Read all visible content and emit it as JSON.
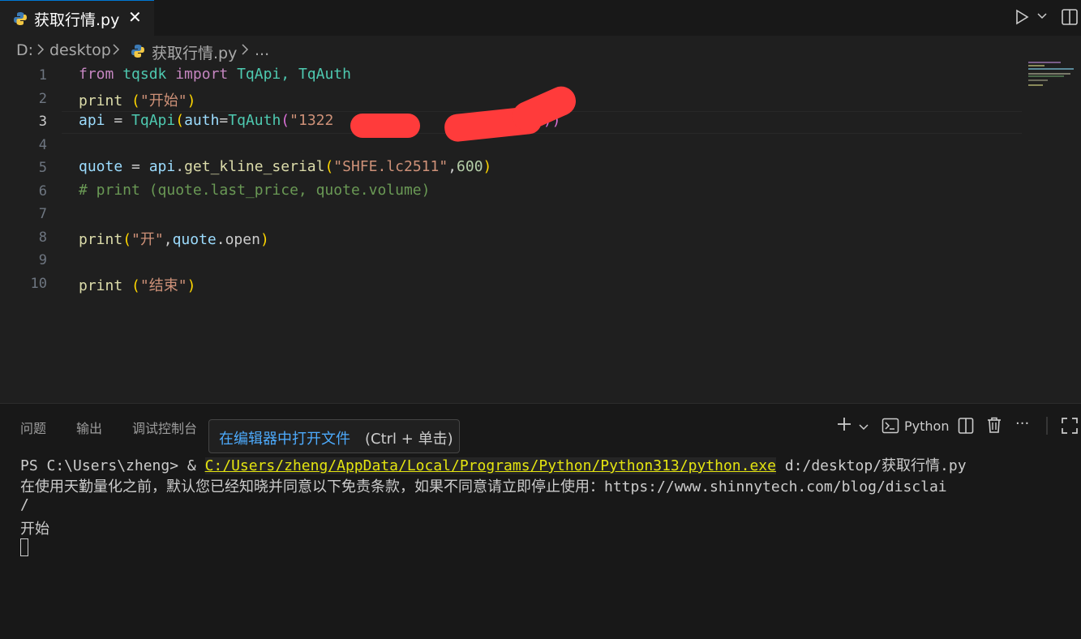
{
  "tab": {
    "label": "获取行情.py",
    "close": "✕"
  },
  "breadcrumb": {
    "drive": "D:",
    "folder": "desktop",
    "file": "获取行情.py",
    "more": "..."
  },
  "editor": {
    "line_numbers": [
      "1",
      "2",
      "3",
      "4",
      "5",
      "6",
      "7",
      "8",
      "9",
      "10"
    ],
    "active_line": 3,
    "lines": {
      "l1": {
        "from": "from",
        "tqsdk": " tqsdk ",
        "import": "import",
        "classes": " TqApi, TqAuth"
      },
      "l2": {
        "print": "print",
        "sp": " ",
        "open": "(",
        "str": "\"开始\"",
        "close": ")"
      },
      "l3": {
        "api": "api",
        "eq": " = ",
        "TqApi": "TqApi",
        "p1": "(",
        "auth": "auth",
        "eq2": "=",
        "TqAuth": "TqAuth",
        "p2": "(",
        "s1": "\"1322",
        "s2": "\", ",
        "p3": "))"
      },
      "l5": {
        "quote": "quote",
        "eq": " = ",
        "api": "api",
        "dot": ".",
        "fn": "get_kline_serial",
        "p1": "(",
        "str": "\"SHFE.lc2511\"",
        "comma": ",",
        "num": "600",
        "p2": ")"
      },
      "l6": {
        "comment": "# print (quote.last_price, quote.volume)"
      },
      "l8": {
        "print": "print",
        "p1": "(",
        "str": "\"开\"",
        "comma": ",",
        "quote": "quote",
        "dot": ".",
        "open": "open",
        "p2": ")"
      },
      "l10": {
        "print": "print",
        "sp": " ",
        "p1": "(",
        "str": "\"结束\"",
        "p2": ")"
      }
    }
  },
  "panel": {
    "tabs": [
      "问题",
      "输出",
      "调试控制台"
    ],
    "tooltip": {
      "link": "在编辑器中打开文件",
      "hint": "(Ctrl + 单击)"
    },
    "terminal_name": "Python",
    "actions": {
      "add": "+",
      "more": "···"
    }
  },
  "terminal": {
    "prompt": "PS C:\\Users\\zheng> & ",
    "exe": "C:/Users/zheng/AppData/Local/Programs/Python/Python313/python.exe",
    "script": " d:/desktop/获取行情.py",
    "line2": "在使用天勤量化之前，默认您已经知晓并同意以下免责条款，如果不同意请立即停止使用：https://www.shinnytech.com/blog/disclai",
    "line3": "/",
    "line4": "开始"
  },
  "colors": {
    "accent": "#0078d4",
    "redaction": "#ff3b3b",
    "link_yellow": "#e5e510"
  }
}
